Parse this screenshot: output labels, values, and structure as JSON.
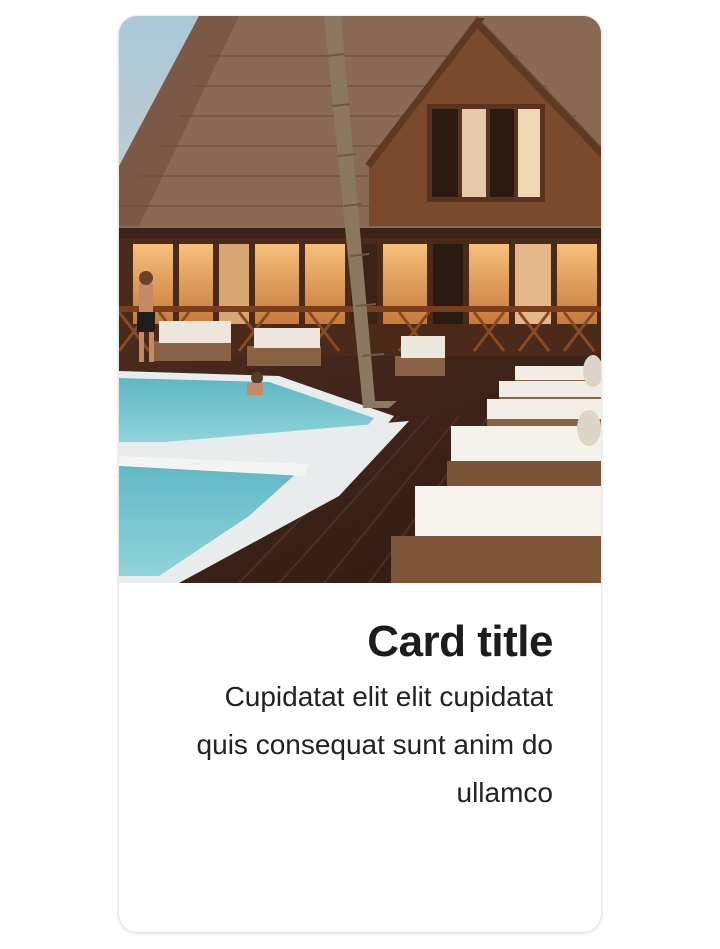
{
  "card": {
    "image_alt": "Resort house with pool and lounge chairs",
    "title": "Card title",
    "text": "Cupidatat elit elit cupidatat quis consequat sunt anim do ullamco"
  },
  "colors": {
    "title": "#1c1c1c",
    "text": "#222222",
    "card_background": "#ffffff"
  }
}
